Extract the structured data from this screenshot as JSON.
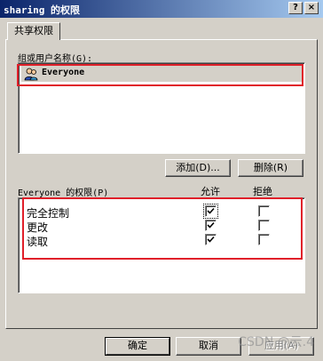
{
  "window": {
    "title": "sharing 的权限",
    "help_button": "?",
    "close_button": "×"
  },
  "tabs": [
    {
      "label": "共享权限"
    }
  ],
  "groups": {
    "label": "组或用户名称(G):",
    "items": [
      {
        "name": "Everyone",
        "icon": "user-group-icon",
        "selected": true
      }
    ],
    "add_button": "添加(D)...",
    "remove_button": "删除(R)"
  },
  "permissions": {
    "label": "Everyone 的权限(P)",
    "allow_header": "允许",
    "deny_header": "拒绝",
    "rows": [
      {
        "name": "完全控制",
        "allow": true,
        "deny": false
      },
      {
        "name": "更改",
        "allow": true,
        "deny": false
      },
      {
        "name": "读取",
        "allow": true,
        "deny": false
      }
    ]
  },
  "footer": {
    "ok_button": "确定",
    "cancel_button": "取消",
    "apply_button": "应用(A)"
  },
  "watermark": "CSDN @云.4",
  "colors": {
    "highlight": "#e0202a",
    "titlebar_start": "#0a246a",
    "titlebar_end": "#a6caf0",
    "face": "#d4d0c8"
  }
}
